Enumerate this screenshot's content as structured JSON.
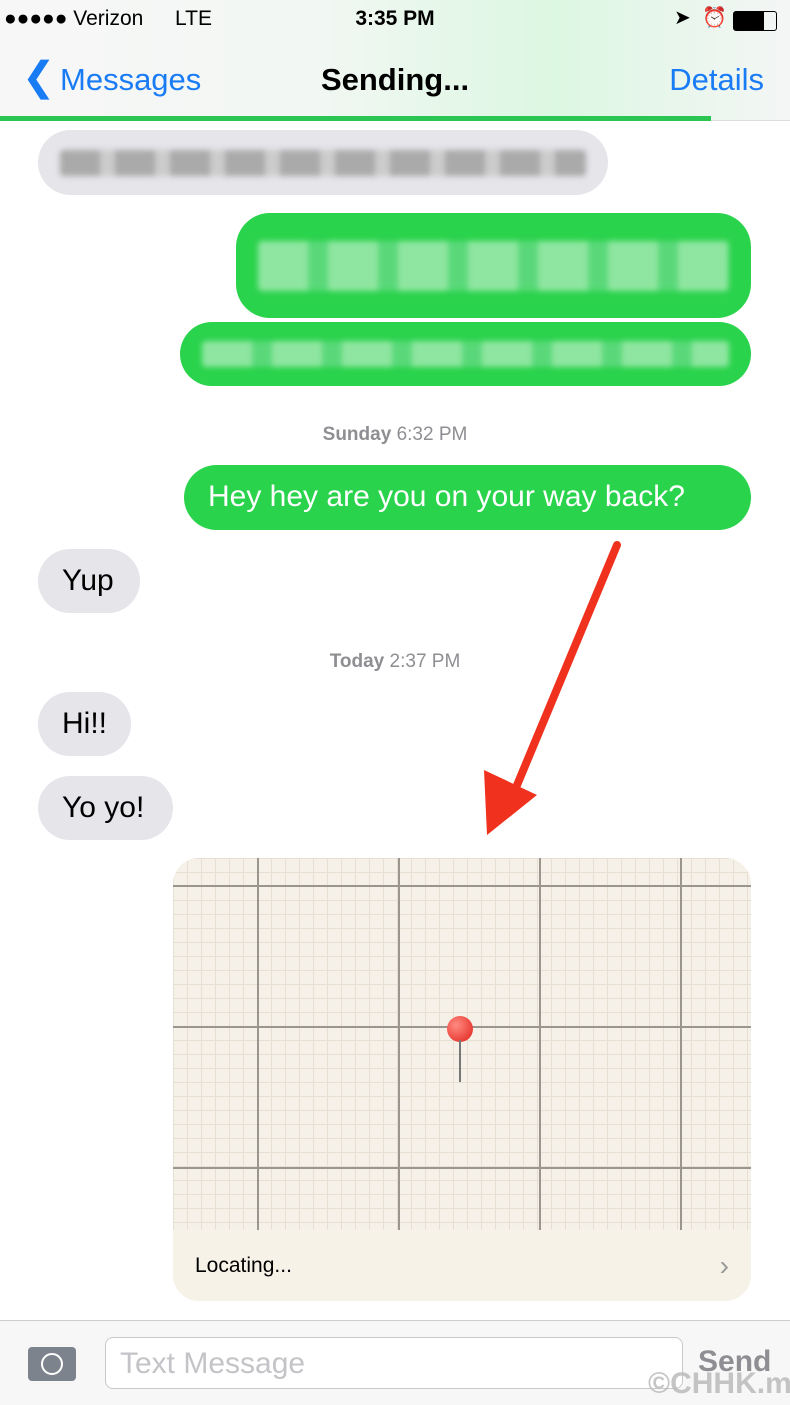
{
  "status_bar": {
    "carrier": "●●●●● Verizon",
    "network": "LTE",
    "time": "3:35 PM"
  },
  "nav": {
    "back_label": "Messages",
    "title": "Sending...",
    "details_label": "Details",
    "send_progress_percent": 90
  },
  "colors": {
    "accent": "#1a7cf5",
    "sent_bubble": "#2ad34c",
    "received_bubble": "#e5e5ea"
  },
  "messages": [
    {
      "type": "received",
      "text": "",
      "blurred": true
    },
    {
      "type": "sent",
      "text": "",
      "blurred": true
    },
    {
      "type": "sent",
      "text": "",
      "blurred": true
    },
    {
      "type": "timestamp",
      "day": "Sunday",
      "time": "6:32 PM"
    },
    {
      "type": "sent",
      "text": "Hey hey are you on your way back?"
    },
    {
      "type": "received",
      "text": "Yup"
    },
    {
      "type": "timestamp",
      "day": "Today",
      "time": "2:37 PM"
    },
    {
      "type": "received",
      "text": "Hi!!"
    },
    {
      "type": "received",
      "text": "Yo yo!"
    },
    {
      "type": "location",
      "status": "Locating..."
    }
  ],
  "input": {
    "placeholder": "Text Message",
    "send_label": "Send"
  },
  "watermark": "©CHHK.mn"
}
